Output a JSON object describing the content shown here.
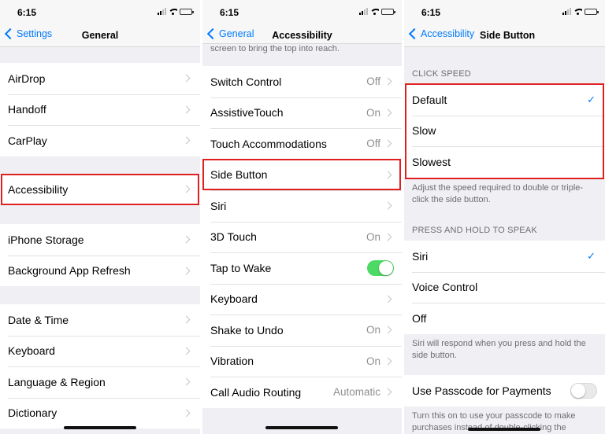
{
  "status_time": "6:15",
  "panels": {
    "general": {
      "back_label": "Settings",
      "title": "General",
      "group1": [
        {
          "label": "AirDrop"
        },
        {
          "label": "Handoff"
        },
        {
          "label": "CarPlay"
        }
      ],
      "group2": [
        {
          "label": "Accessibility"
        }
      ],
      "group3": [
        {
          "label": "iPhone Storage"
        },
        {
          "label": "Background App Refresh"
        }
      ],
      "group4": [
        {
          "label": "Date & Time"
        },
        {
          "label": "Keyboard"
        },
        {
          "label": "Language & Region"
        },
        {
          "label": "Dictionary"
        }
      ]
    },
    "accessibility": {
      "back_label": "General",
      "title": "Accessibility",
      "top_cut_text": "screen to bring the top into reach.",
      "rows": [
        {
          "label": "Switch Control",
          "value": "Off"
        },
        {
          "label": "AssistiveTouch",
          "value": "On"
        },
        {
          "label": "Touch Accommodations",
          "value": "Off"
        },
        {
          "label": "Side Button",
          "value": ""
        },
        {
          "label": "Siri",
          "value": ""
        },
        {
          "label": "3D Touch",
          "value": "On"
        },
        {
          "label": "Tap to Wake",
          "value": ""
        },
        {
          "label": "Keyboard",
          "value": ""
        },
        {
          "label": "Shake to Undo",
          "value": "On"
        },
        {
          "label": "Vibration",
          "value": "On"
        },
        {
          "label": "Call Audio Routing",
          "value": "Automatic"
        }
      ]
    },
    "side_button": {
      "back_label": "Accessibility",
      "title": "Side Button",
      "click_speed_header": "CLICK SPEED",
      "click_speed_options": [
        {
          "label": "Default"
        },
        {
          "label": "Slow"
        },
        {
          "label": "Slowest"
        }
      ],
      "click_speed_footer": "Adjust the speed required to double or triple-click the side button.",
      "press_hold_header": "PRESS AND HOLD TO SPEAK",
      "press_hold_options": [
        {
          "label": "Siri"
        },
        {
          "label": "Voice Control"
        },
        {
          "label": "Off"
        }
      ],
      "press_hold_footer": "Siri will respond when you press and hold the side button.",
      "passcode_label": "Use Passcode for Payments",
      "passcode_footer": "Turn this on to use your passcode to make purchases instead of double-clicking the"
    }
  },
  "colors": {
    "accent": "#007aff",
    "highlight": "#e02020",
    "toggle_on": "#4cd964"
  }
}
